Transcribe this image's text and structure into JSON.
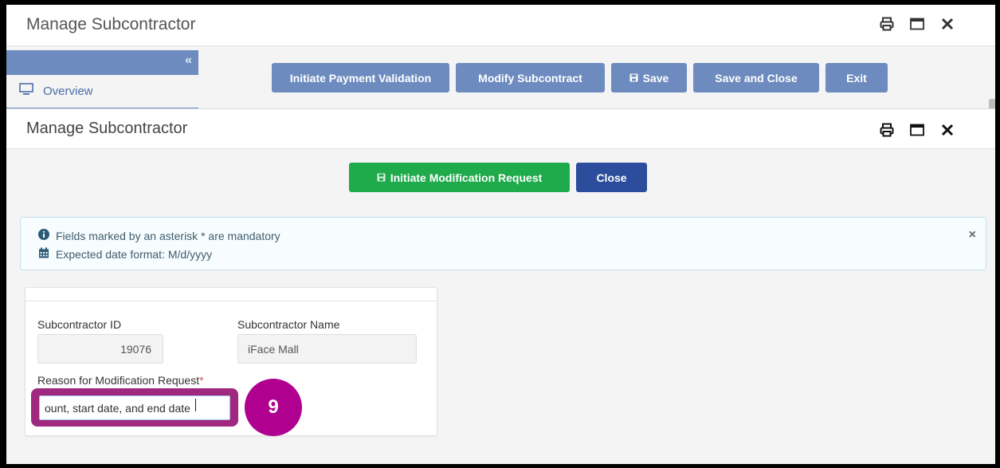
{
  "outer_window": {
    "title": "Manage Subcontractor",
    "icons": [
      "print-icon",
      "maximize-icon",
      "close-icon"
    ],
    "sidebar": {
      "collapse_glyph": "«",
      "items": [
        {
          "label": "Overview",
          "icon": "monitor-icon"
        }
      ]
    },
    "toolbar": {
      "buttons": [
        {
          "label": "Initiate Payment Validation"
        },
        {
          "label": "Modify Subcontract"
        },
        {
          "label": "Save",
          "icon": "save-icon"
        },
        {
          "label": "Save and Close"
        },
        {
          "label": "Exit"
        }
      ]
    }
  },
  "modal": {
    "title": "Manage Subcontractor",
    "icons": [
      "print-icon",
      "maximize-icon",
      "close-icon"
    ],
    "actions": {
      "primary_label": "Initiate Modification Request",
      "primary_icon": "save-icon",
      "secondary_label": "Close"
    },
    "alert": {
      "lines": [
        {
          "icon": "info-icon",
          "text": "Fields marked by an asterisk * are mandatory"
        },
        {
          "icon": "calendar-icon",
          "text": "Expected date format: M/d/yyyy"
        }
      ],
      "close_glyph": "×"
    },
    "form": {
      "subcontractor_id": {
        "label": "Subcontractor ID",
        "value": "19076"
      },
      "subcontractor_name": {
        "label": "Subcontractor Name",
        "value": "iFace Mall"
      },
      "reason": {
        "label": "Reason for Modification Request",
        "required_mark": "*",
        "value": "ount, start date, and end date"
      }
    }
  },
  "annotation": {
    "step_number": "9",
    "colors": {
      "highlight": "#a0287f",
      "badge": "#b0008f"
    }
  },
  "colors": {
    "toolbar_button": "#6d8bbf",
    "primary_green": "#1faa4b",
    "navy": "#2b4d9b",
    "alert_bg": "#f7fcfe",
    "alert_border": "#bfe3ef"
  }
}
